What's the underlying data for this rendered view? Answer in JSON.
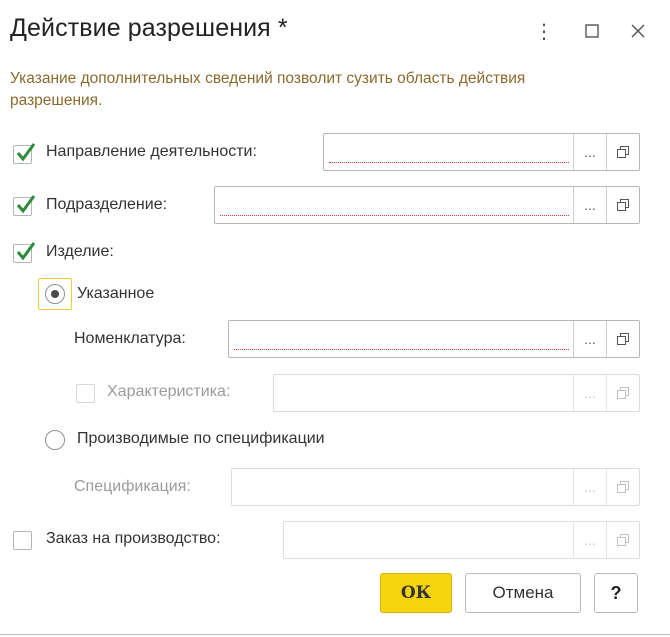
{
  "window": {
    "title": "Действие разрешения *",
    "more_glyph": "⋮",
    "maximize_glyph": "☐",
    "close_glyph": "✕"
  },
  "description": "Указание дополнительных сведений позволит сузить область действия разрешения.",
  "fields": {
    "direction": {
      "label": "Направление деятельности:",
      "checked": true,
      "value": "",
      "required": true
    },
    "division": {
      "label": "Подразделение:",
      "checked": true,
      "value": "",
      "required": true
    },
    "product": {
      "label": "Изделие:",
      "checked": true
    },
    "specified": {
      "label": "Указанное",
      "selected": true
    },
    "nomenclature": {
      "label": "Номенклатура:",
      "value": "",
      "required": true
    },
    "characteristic": {
      "label": "Характеристика:",
      "checked": false,
      "enabled": false,
      "value": ""
    },
    "by_spec": {
      "label": "Производимые по спецификации",
      "selected": false
    },
    "specification": {
      "label": "Спецификация:",
      "enabled": false,
      "value": ""
    },
    "production_order": {
      "label": "Заказ на производство:",
      "checked": false,
      "value": ""
    }
  },
  "field_buttons": {
    "select": "...",
    "open_icon": "open-in-new-window-icon"
  },
  "buttons": {
    "ok": "ОК",
    "cancel": "Отмена",
    "help": "?"
  },
  "colors": {
    "accent_yellow": "#f5d40f",
    "description_text": "#8a6a2e",
    "required_underline": "#e23a3a",
    "check": "#2e8b3c"
  }
}
